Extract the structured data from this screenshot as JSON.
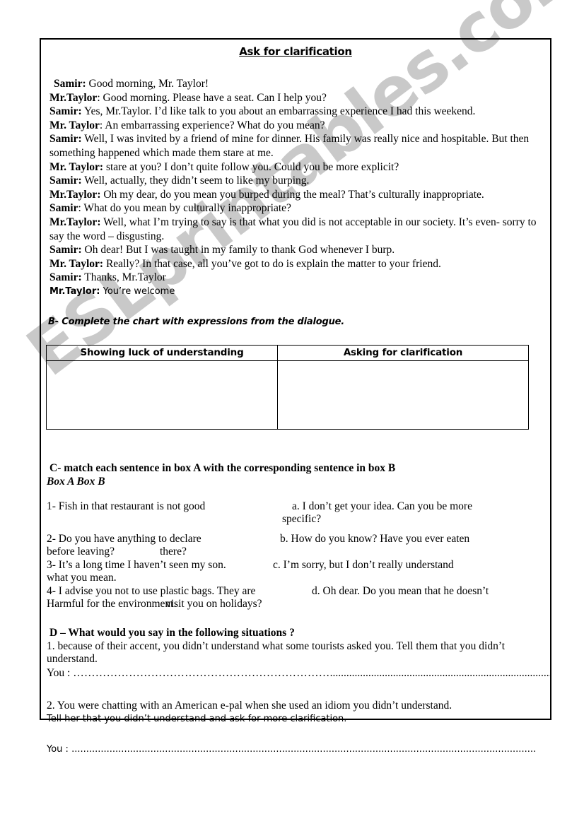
{
  "watermark": {
    "text": "ESLprintables.com",
    "color": "#c9c9c9"
  },
  "document": {
    "title": "Ask for clarification"
  },
  "dialogue": [
    {
      "speaker": "Samir:",
      "text": " Good morning, Mr. Taylor!"
    },
    {
      "speaker": "Mr.Taylor",
      "text": ": Good morning. Please have a seat. Can I help you?"
    },
    {
      "speaker": "Samir:",
      "text": " Yes, Mr.Taylor. I’d like talk to you about an embarrassing experience I had this weekend."
    },
    {
      "speaker": "Mr. Taylor",
      "text": ": An embarrassing experience? What do you mean?"
    },
    {
      "speaker": "Samir:",
      "text": " Well, I was invited by a friend of mine for dinner. His family was really nice and hospitable. But then something happened which made them stare at me."
    },
    {
      "speaker": "Mr. Taylor:",
      "text": " stare at you? I don’t quite follow you. Could you be more explicit?"
    },
    {
      "speaker": "Samir:",
      "text": " Well, actually, they didn’t seem to like my burping."
    },
    {
      "speaker": "Mr.Taylor:",
      "text": " Oh my dear, do you mean you burped during the meal? That’s culturally inappropriate."
    },
    {
      "speaker": "Samir",
      "text": ": What do you mean by culturally inappropriate?"
    },
    {
      "speaker": "Mr.Taylor:",
      "text": " Well, what I’m trying to say is that what you did is not acceptable in our society. It’s even- sorry to say the word – disgusting."
    },
    {
      "speaker": "Samir:",
      "text": " Oh dear! But I was taught in my family to thank God whenever I burp."
    },
    {
      "speaker": "Mr. Taylor:",
      "text": " Really? In that case, all you’ve got to do is explain the matter to your friend."
    },
    {
      "speaker": "Samir:",
      "text": " Thanks, Mr.Taylor"
    },
    {
      "speaker": "Mr.Taylor:",
      "text": " You’re welcome"
    }
  ],
  "section_b": {
    "heading": "B- Complete the chart with expressions from the dialogue.",
    "table": {
      "headers": [
        "Showing luck of understanding",
        "Asking for clarification"
      ],
      "rows": [
        [
          "",
          ""
        ]
      ]
    }
  },
  "section_c": {
    "heading": "C- match each sentence in box A with the corresponding sentence in box B",
    "box_labels": "Box A Box B",
    "items": [
      {
        "left": "1- Fish in that restaurant is not good",
        "right": "a. I don’t get your idea. Can you be more",
        "right_cont": "specific?",
        "left_cont": ""
      },
      {
        "left": "2- Do you have anything to declare",
        "right": "b. How do you know? Have you ever eaten",
        "left_cont": "before leaving?",
        "right_cont": "there?"
      },
      {
        "left": "3- It’s a long time I haven’t seen my son.",
        "right": "c. I’m sorry, but I don’t really understand",
        "left_cont": "what you mean.",
        "right_cont": ""
      },
      {
        "left": "4- I advise you not to use plastic bags. They are",
        "right": "d. Oh dear. Do you mean that he doesn’t",
        "left_cont": "Harmful for the environment.",
        "right_cont": "visit you on holidays?"
      }
    ]
  },
  "section_d": {
    "heading": "D – What would you say in the following situations ?",
    "situation_1": {
      "text_line1": "1. because of their accent, you didn’t understand what some tourists asked you. Tell them that you didn’t",
      "text_line2": "understand.",
      "answer_label": "You : ",
      "dots_1": "……………………………………………………………",
      "dots_2": "...................................................................................................................."
    },
    "situation_2": {
      "text_line1": "2. You were chatting with an American e-pal when she used an idiom you didn’t understand.",
      "text_line2": "Tell her that you didn’t understand and ask for more clarification.",
      "answer_label": "You : ",
      "dots": "..............................................................................................................................................................."
    }
  }
}
